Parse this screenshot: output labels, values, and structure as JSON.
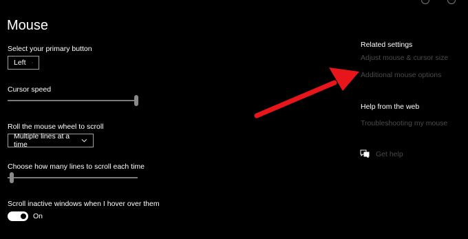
{
  "page": {
    "title": "Mouse"
  },
  "primary_button": {
    "label": "Select your primary button",
    "value": "Left"
  },
  "cursor_speed": {
    "label": "Cursor speed",
    "level": 1.0
  },
  "scroll_wheel": {
    "label": "Roll the mouse wheel to scroll",
    "value": "Multiple lines at a time"
  },
  "lines_to_scroll": {
    "label": "Choose how many lines to scroll each time",
    "level": 0.0
  },
  "scroll_inactive": {
    "label": "Scroll inactive windows when I hover over them",
    "state": "On"
  },
  "related_settings": {
    "header": "Related settings",
    "links": [
      "Adjust mouse & cursor size",
      "Additional mouse options"
    ]
  },
  "help_web": {
    "header": "Help from the web",
    "links": [
      "Troubleshooting my mouse"
    ]
  },
  "get_help": {
    "label": "Get help"
  },
  "colors": {
    "background": "#000000",
    "text": "#ffffff",
    "link_dim": "#4a4a4a",
    "arrow": "#e8151b"
  }
}
